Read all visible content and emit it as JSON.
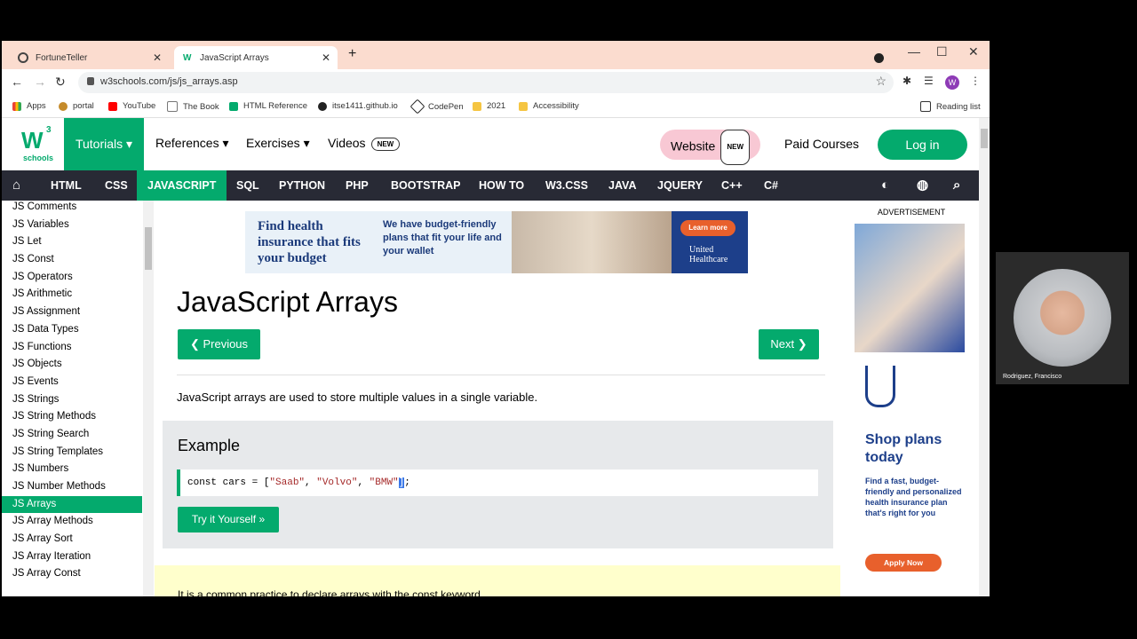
{
  "browser": {
    "tabs": [
      {
        "title": "FortuneTeller",
        "active": false
      },
      {
        "title": "JavaScript Arrays",
        "active": true
      }
    ],
    "new_tab": "+",
    "url": "w3schools.com/js/js_arrays.asp",
    "profile_initial": "W",
    "bookmarks": [
      "Apps",
      "portal",
      "YouTube",
      "The Book",
      "HTML Reference",
      "itse1411.github.io",
      "CodePen",
      "2021",
      "Accessibility"
    ],
    "reading_list": "Reading list"
  },
  "site": {
    "logo_w": "W",
    "logo_sup": "3",
    "logo_sub": "schools",
    "menu": {
      "tutorials": "Tutorials ▾",
      "references": "References ▾",
      "exercises": "Exercises ▾",
      "videos": "Videos",
      "videos_badge": "NEW",
      "website": "Website",
      "website_badge": "NEW",
      "paid_courses": "Paid Courses",
      "login": "Log in"
    },
    "subnav": [
      "HTML",
      "CSS",
      "JAVASCRIPT",
      "SQL",
      "PYTHON",
      "PHP",
      "BOOTSTRAP",
      "HOW TO",
      "W3.CSS",
      "JAVA",
      "JQUERY",
      "C++",
      "C#"
    ],
    "sidebar": [
      "JS Comments",
      "JS Variables",
      "JS Let",
      "JS Const",
      "JS Operators",
      "JS Arithmetic",
      "JS Assignment",
      "JS Data Types",
      "JS Functions",
      "JS Objects",
      "JS Events",
      "JS Strings",
      "JS String Methods",
      "JS String Search",
      "JS String Templates",
      "JS Numbers",
      "JS Number Methods",
      "JS Arrays",
      "JS Array Methods",
      "JS Array Sort",
      "JS Array Iteration",
      "JS Array Const"
    ],
    "sidebar_active": "JS Arrays"
  },
  "ad_top": {
    "headline": "Find health insurance that fits your budget",
    "text": "We have budget-friendly plans that fit your life and your wallet",
    "cta": "Learn more",
    "brand": "United Healthcare"
  },
  "content": {
    "title": "JavaScript Arrays",
    "prev": "❮ Previous",
    "next": "Next ❯",
    "intro": "JavaScript arrays are used to store multiple values in a single variable.",
    "example_title": "Example",
    "code_prefix": "const cars = [",
    "code_s1": "\"Saab\"",
    "code_s2": "\"Volvo\"",
    "code_s3": "\"BMW\"",
    "code_close": "]",
    "code_end": ";",
    "try_it": "Try it Yourself »",
    "note_partial": "It is a common practice to declare arrays with the const keyword."
  },
  "ad_right": {
    "label": "ADVERTISEMENT",
    "headline": "Shop plans today",
    "text": "Find a fast, budget-friendly and personalized health insurance plan that's right for you",
    "cta": "Apply Now"
  },
  "webcam": {
    "name": "Rodriguez, Francisco"
  },
  "colors": {
    "brand_green": "#04AA6D",
    "nav_dark": "#282A35",
    "tab_strip": "#fbdccf"
  }
}
